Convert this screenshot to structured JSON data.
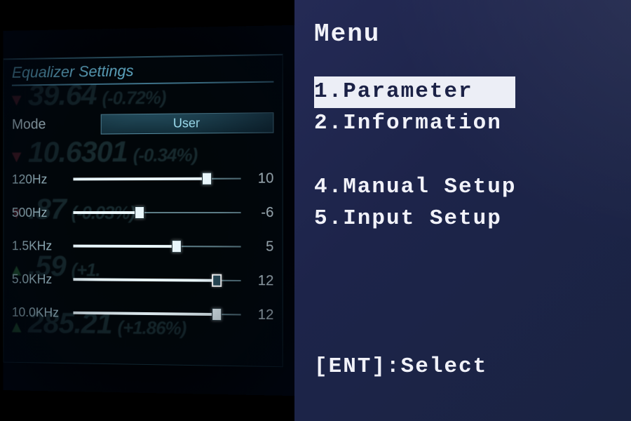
{
  "equalizer": {
    "title": "Equalizer Settings",
    "mode_label": "Mode",
    "mode_value": "User",
    "bands": [
      {
        "label": "120Hz",
        "value": "10",
        "pos": 0.8,
        "selected": false
      },
      {
        "label": "500Hz",
        "value": "-6",
        "pos": 0.4,
        "selected": false
      },
      {
        "label": "1.5KHz",
        "value": "5",
        "pos": 0.62,
        "selected": false
      },
      {
        "label": "5.0KHz",
        "value": "12",
        "pos": 0.86,
        "selected": true
      },
      {
        "label": "10.0KHz",
        "value": "12",
        "pos": 0.86,
        "selected": false
      }
    ],
    "ticker": [
      {
        "dir": "down",
        "value": "39.64",
        "pct": "(-0.72%)"
      },
      {
        "dir": "down",
        "value": "10.6301",
        "pct": "(-0.34%)"
      },
      {
        "dir": "down",
        "value": ".87",
        "pct": "(-0.03%)"
      },
      {
        "dir": "up",
        "value": ".59",
        "pct": "(+1."
      },
      {
        "dir": "up",
        "value": "285.21",
        "pct": "(+1.86%)"
      }
    ]
  },
  "menu": {
    "heading": "Menu",
    "items": [
      {
        "n": "1",
        "label": "Parameter",
        "selected": true
      },
      {
        "n": "2",
        "label": "Information",
        "selected": false
      },
      {
        "n": "",
        "label": "",
        "gap": true
      },
      {
        "n": "4",
        "label": "Manual Setup",
        "selected": false
      },
      {
        "n": "5",
        "label": "Input Setup",
        "selected": false
      }
    ],
    "hint": "[ENT]:Select"
  }
}
